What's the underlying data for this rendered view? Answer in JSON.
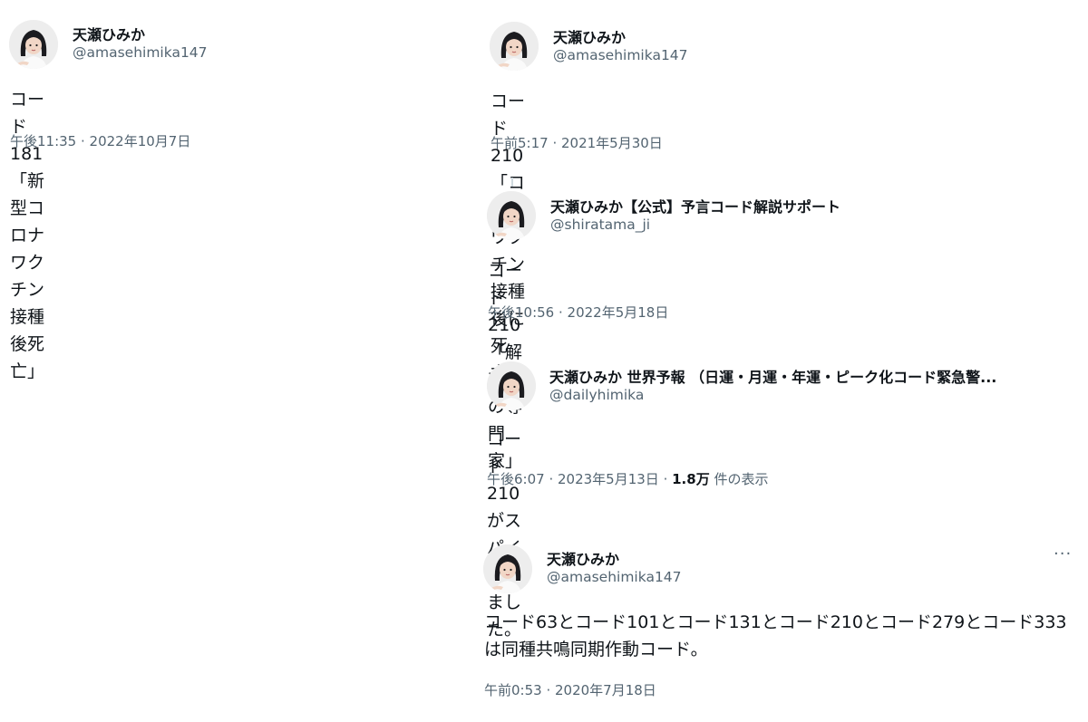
{
  "tweets": [
    {
      "name": "天瀬ひみか",
      "handle": "@amasehimika147",
      "text": "コード181「新型コロナワクチン接種後死亡」",
      "time": "午後11:35",
      "date": "2022年10月7日"
    },
    {
      "name": "天瀬ひみか",
      "handle": "@amasehimika147",
      "text": "コード210「コロナワクチン接種後に死亡」",
      "time": "午前5:17",
      "date": "2021年5月30日"
    },
    {
      "name": "天瀬ひみか【公式】予言コード解説サポート",
      "handle": "@shiratama_ji",
      "text": "コード210「解剖学の専門家」",
      "time": "午後10:56",
      "date": "2022年5月18日"
    },
    {
      "name": "天瀬ひみか 世界予報 （日運・月運・年運・ピーク化コード緊急警...",
      "handle": "@dailyhimika",
      "text": "コード210がスパイクしました。",
      "time": "午後6:07",
      "date": "2023年5月13日",
      "views_count": "1.8万",
      "views_label": "件の表示"
    },
    {
      "name": "天瀬ひみか",
      "handle": "@amasehimika147",
      "text_line1": "コード63とコード101とコード131とコード210とコード279とコード333",
      "text_line2": "は同種共鳴同期作動コード。",
      "time": "午前0:53",
      "date": "2020年7月18日",
      "more_icon": "···"
    }
  ],
  "separator": " · ",
  "icons": {
    "avatar": "avatar-photo-icon",
    "more": "more-options-icon"
  },
  "colors": {
    "text_primary": "#0f1419",
    "text_secondary": "#536471",
    "thread_line": "#cfd9de"
  }
}
